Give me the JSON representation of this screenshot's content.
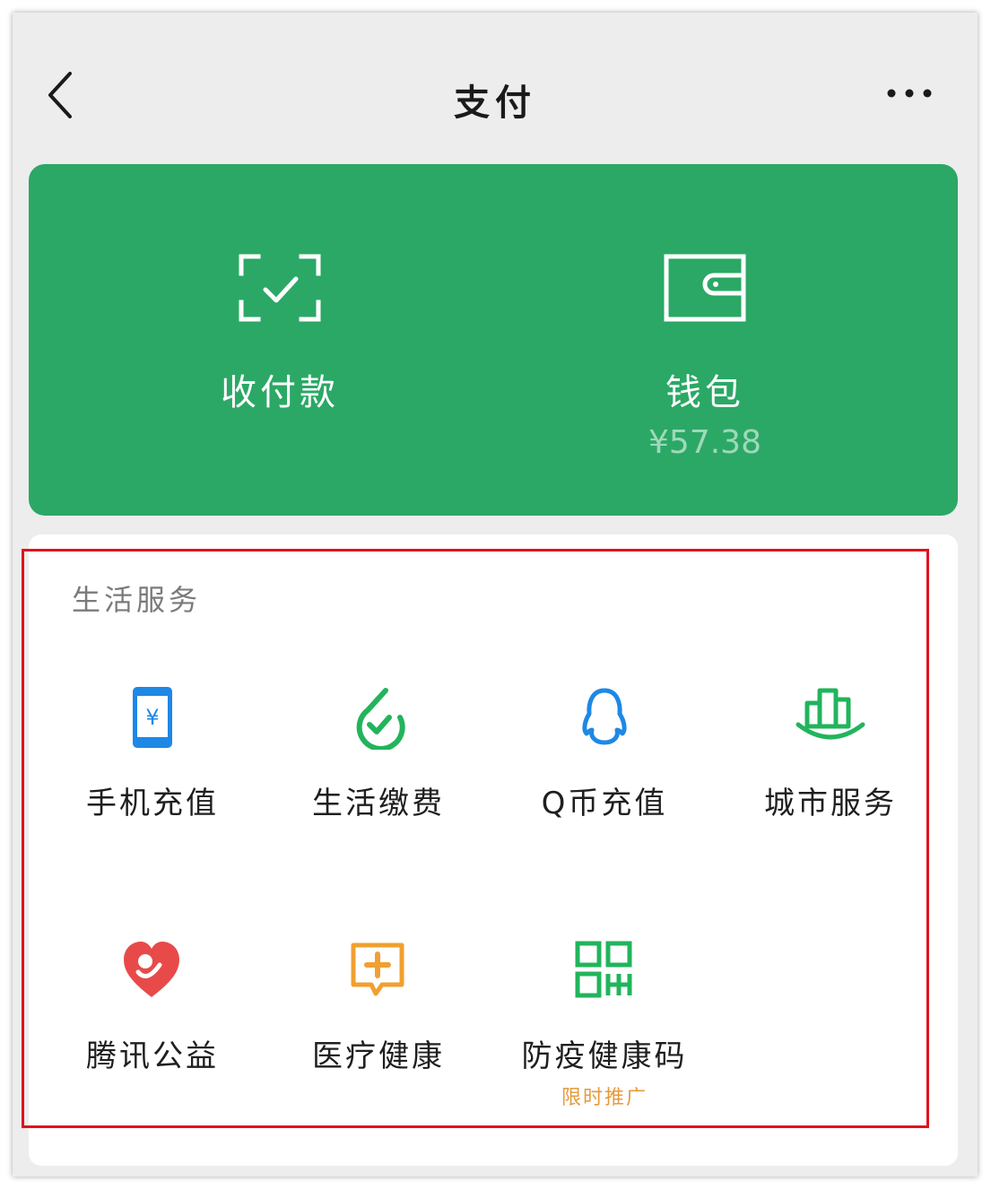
{
  "header": {
    "title": "支付",
    "back_icon": "chevron-left-icon",
    "more_icon": "more-dots-icon"
  },
  "pay_card": {
    "color": "#2ba866",
    "receive_pay": {
      "label": "收付款",
      "icon": "scan-check-icon"
    },
    "wallet": {
      "label": "钱包",
      "balance": "¥57.38",
      "icon": "wallet-icon"
    }
  },
  "life_services": {
    "title": "生活服务",
    "items": [
      {
        "label": "手机充值",
        "icon": "phone-recharge-icon",
        "color": "#1e88e5"
      },
      {
        "label": "生活缴费",
        "icon": "bill-payment-icon",
        "color": "#22b45c"
      },
      {
        "label": "Q币充值",
        "icon": "qq-penguin-icon",
        "color": "#1e88e5"
      },
      {
        "label": "城市服务",
        "icon": "city-services-icon",
        "color": "#22b45c"
      },
      {
        "label": "腾讯公益",
        "icon": "charity-heart-icon",
        "color": "#e84a4a"
      },
      {
        "label": "医疗健康",
        "icon": "medical-chat-icon",
        "color": "#f0a030"
      },
      {
        "label": "防疫健康码",
        "icon": "health-qr-icon",
        "color": "#22b45c",
        "promo": "限时推广"
      }
    ]
  }
}
